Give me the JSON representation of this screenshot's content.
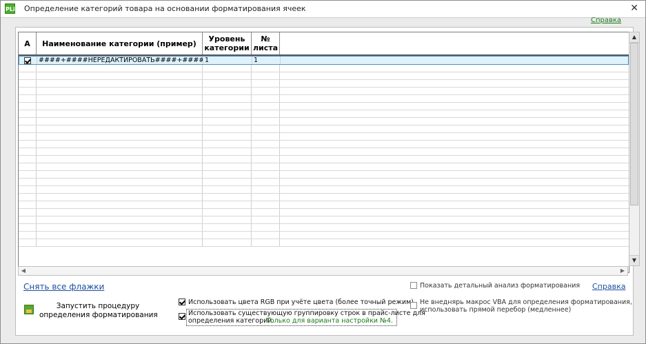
{
  "window": {
    "icon_text": "PLi",
    "title": "Определение категорий товара на основании форматирования ячеек",
    "close_glyph": "✕",
    "help_link": "Справка"
  },
  "grid": {
    "columns": [
      "A",
      "Наименование категории (пример)",
      "Уровень категории",
      "№ листа"
    ],
    "rows": [
      {
        "checked": true,
        "name": "####+####НЕРЕДАКТИРОВАТЬ####+####",
        "level": "1",
        "sheet": "1"
      }
    ],
    "empty_row_count": 24
  },
  "footer": {
    "clear_flags_link": "Снять все флажки",
    "run_button_line1": "Запустить процедуру",
    "run_button_line2": "определения форматирования",
    "option_rgb": {
      "checked": true,
      "label": "Использовать цвета RGB при учёте цвета (более точный режим)."
    },
    "option_grouping": {
      "checked": true,
      "label_line1": "Использовать существующую группировку строк в прайс-листе для",
      "label_line2": "определения категорий.",
      "note": "Только для варианта настройки №4."
    },
    "option_detail": {
      "checked": false,
      "label": "Показать детальный анализ форматирования"
    },
    "option_no_vba": {
      "checked": false,
      "label_line1": "Не внеднярь макрос VBA для определения форматирования,",
      "label_line2": "использовать прямой перебор (медленнее)"
    },
    "help_link": "Справка"
  }
}
